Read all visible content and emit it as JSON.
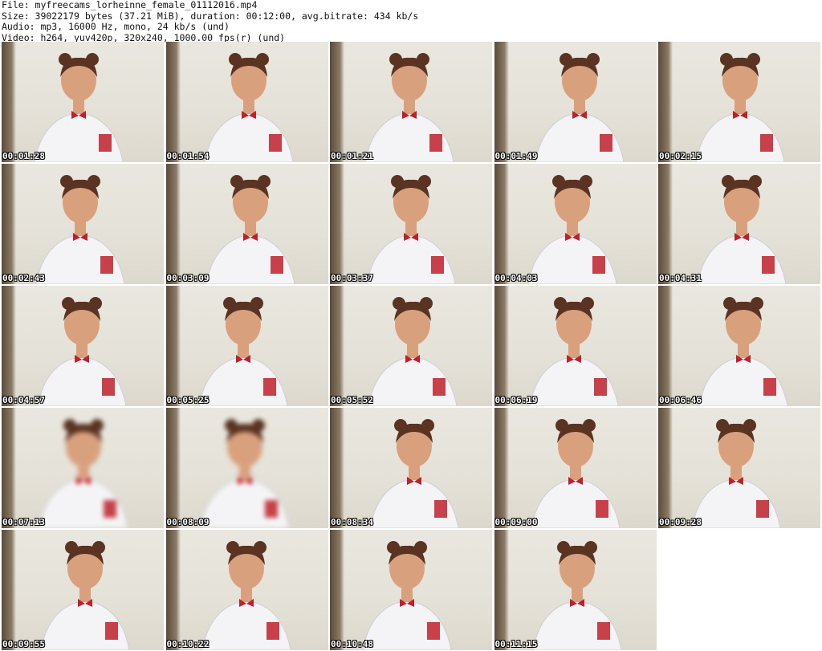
{
  "header": {
    "file": "File: myfreecams_lorheinne_female_01112016.mp4",
    "size": "Size: 39022179 bytes (37.21 MiB), duration: 00:12:00, avg.bitrate: 434 kb/s",
    "audio": "Audio: mp3, 16000 Hz, mono, 24 kb/s (und)",
    "video": "Video: h264, yuv420p, 320x240, 1000.00 fps(r) (und)"
  },
  "thumbnails": [
    {
      "ts": "00:01:28"
    },
    {
      "ts": "00:01:54"
    },
    {
      "ts": "00:01:21"
    },
    {
      "ts": "00:01:49"
    },
    {
      "ts": "00:02:15"
    },
    {
      "ts": "00:02:43"
    },
    {
      "ts": "00:03:09"
    },
    {
      "ts": "00:03:37"
    },
    {
      "ts": "00:04:03"
    },
    {
      "ts": "00:04:31"
    },
    {
      "ts": "00:04:57"
    },
    {
      "ts": "00:05:25"
    },
    {
      "ts": "00:05:52"
    },
    {
      "ts": "00:06:19"
    },
    {
      "ts": "00:06:46"
    },
    {
      "ts": "00:07:13"
    },
    {
      "ts": "00:08:09"
    },
    {
      "ts": "00:08:34"
    },
    {
      "ts": "00:09:00"
    },
    {
      "ts": "00:09:28"
    },
    {
      "ts": "00:09:55"
    },
    {
      "ts": "00:10:22"
    },
    {
      "ts": "00:10:48"
    },
    {
      "ts": "00:11:15"
    }
  ],
  "colors": {
    "shirt": "#f4f4f6",
    "skin": "#d9a07e",
    "hair": "#5a3322",
    "tie": "#c0202c",
    "background_wall": "#e6e3da"
  }
}
